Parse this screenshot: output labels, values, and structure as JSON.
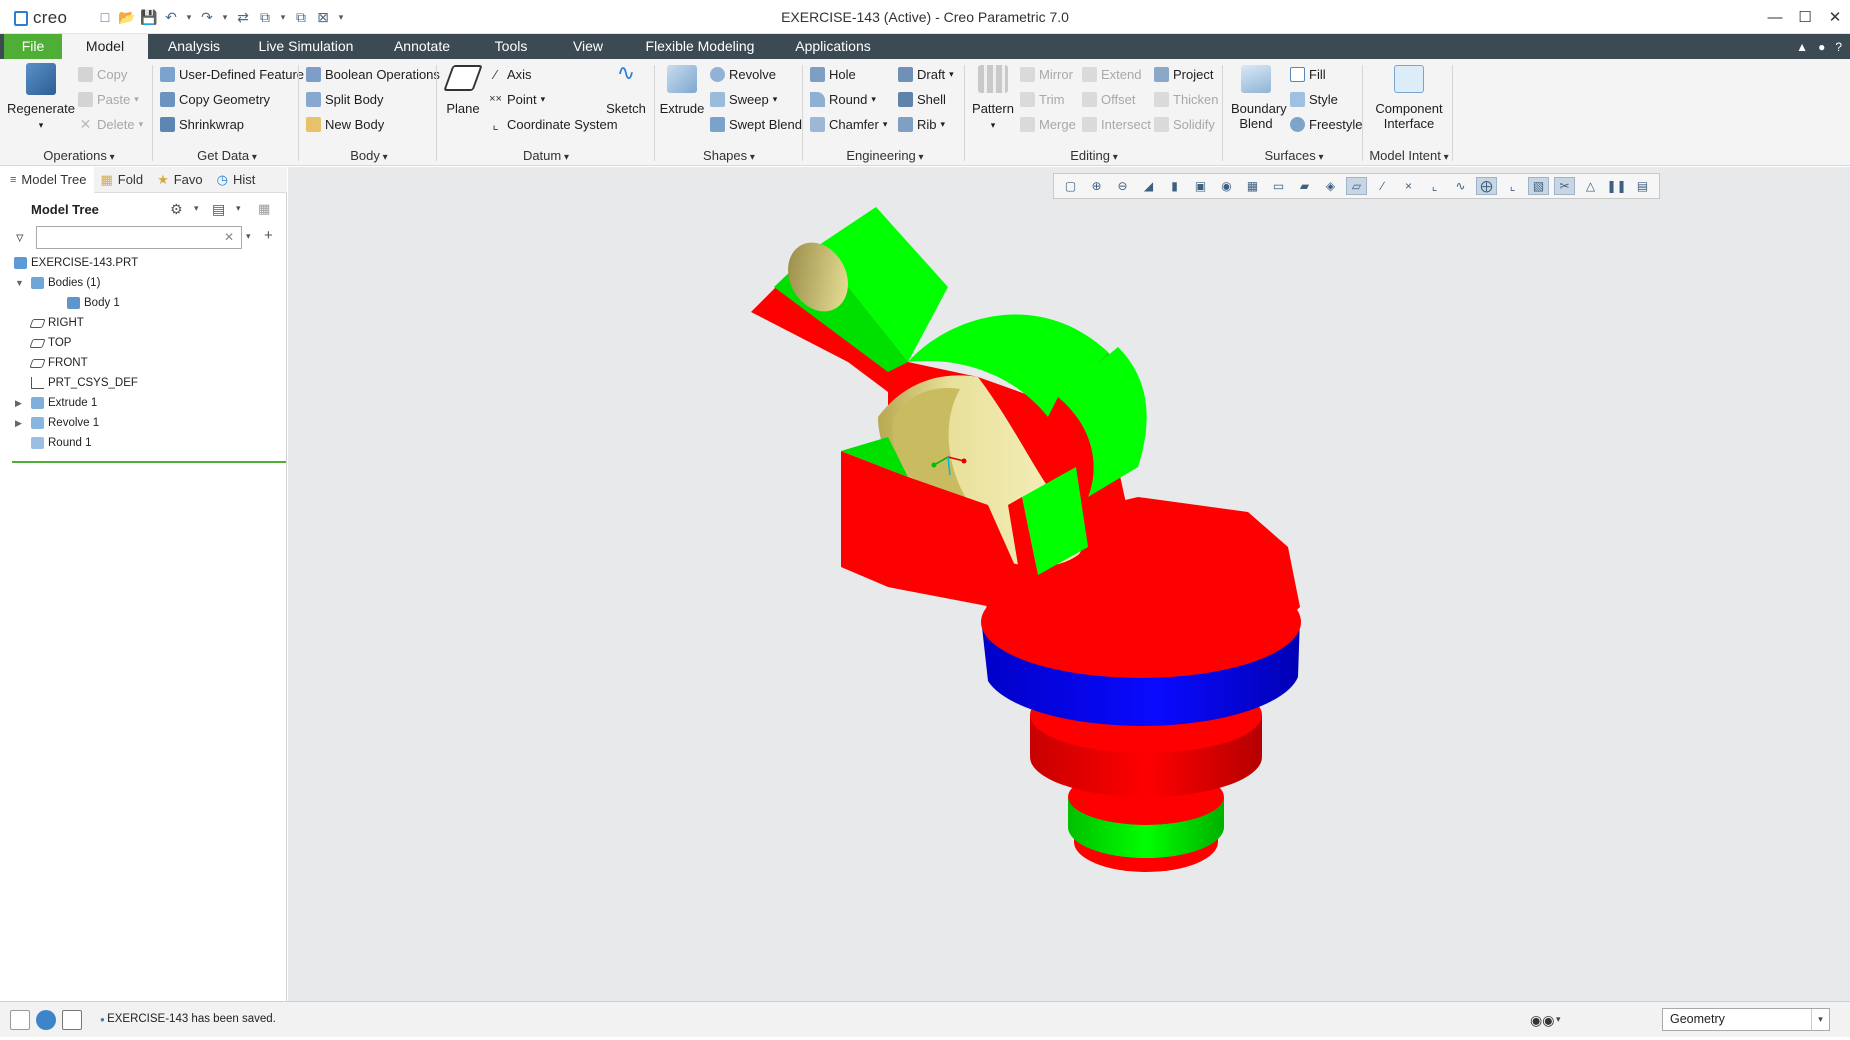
{
  "window": {
    "title": "EXERCISE-143 (Active) - Creo Parametric 7.0",
    "app_logo_text": "creo",
    "controls": {
      "minimize": "—",
      "maximize": "☐",
      "close": "✕"
    }
  },
  "quick_access": [
    "new-icon",
    "open-icon",
    "save-icon",
    "undo-icon",
    "redo-icon",
    "regenerate-icon",
    "windows-icon",
    "repaint-icon",
    "close-window-icon"
  ],
  "tabs": [
    {
      "label": "File"
    },
    {
      "label": "Model"
    },
    {
      "label": "Analysis"
    },
    {
      "label": "Live Simulation"
    },
    {
      "label": "Annotate"
    },
    {
      "label": "Tools"
    },
    {
      "label": "View"
    },
    {
      "label": "Flexible Modeling"
    },
    {
      "label": "Applications"
    }
  ],
  "ribbon": {
    "operations": {
      "label": "Operations",
      "regenerate": "Regenerate",
      "copy": "Copy",
      "paste": "Paste",
      "delete": "Delete"
    },
    "get_data": {
      "label": "Get Data",
      "udf": "User-Defined Feature",
      "copy_geometry": "Copy Geometry",
      "shrinkwrap": "Shrinkwrap"
    },
    "body": {
      "label": "Body",
      "boolean": "Boolean Operations",
      "split": "Split Body",
      "new": "New Body"
    },
    "datum": {
      "label": "Datum",
      "plane": "Plane",
      "axis": "Axis",
      "point": "Point",
      "csys": "Coordinate System",
      "sketch": "Sketch"
    },
    "shapes": {
      "label": "Shapes",
      "extrude": "Extrude",
      "revolve": "Revolve",
      "sweep": "Sweep",
      "swept_blend": "Swept Blend"
    },
    "engineering": {
      "label": "Engineering",
      "hole": "Hole",
      "round": "Round",
      "chamfer": "Chamfer",
      "draft": "Draft",
      "shell": "Shell",
      "rib": "Rib"
    },
    "editing": {
      "label": "Editing",
      "pattern": "Pattern",
      "mirror": "Mirror",
      "trim": "Trim",
      "merge": "Merge",
      "extend": "Extend",
      "offset": "Offset",
      "intersect": "Intersect",
      "project": "Project",
      "thicken": "Thicken",
      "solidify": "Solidify"
    },
    "surfaces": {
      "label": "Surfaces",
      "boundary_blend": "Boundary Blend",
      "fill": "Fill",
      "style": "Style",
      "freestyle": "Freestyle"
    },
    "model_intent": {
      "label": "Model Intent",
      "component_interface": "Component Interface"
    }
  },
  "left_panel": {
    "tabs": [
      {
        "label": "Model Tree",
        "icon": "model-tree-icon"
      },
      {
        "label": "Fold",
        "icon": "folder-icon"
      },
      {
        "label": "Favo",
        "icon": "favorites-icon"
      },
      {
        "label": "Hist",
        "icon": "history-icon"
      }
    ],
    "tree_title": "Model Tree",
    "search_placeholder": "",
    "tree": [
      {
        "label": "EXERCISE-143.PRT",
        "icon": "part-icon",
        "level": 0,
        "expander": ""
      },
      {
        "label": "Bodies (1)",
        "icon": "bodies-icon",
        "level": 0,
        "expander": "▼"
      },
      {
        "label": "Body 1",
        "icon": "body-icon",
        "level": 1,
        "expander": ""
      },
      {
        "label": "RIGHT",
        "icon": "datum-plane-icon",
        "level": 0,
        "expander": ""
      },
      {
        "label": "TOP",
        "icon": "datum-plane-icon",
        "level": 0,
        "expander": ""
      },
      {
        "label": "FRONT",
        "icon": "datum-plane-icon",
        "level": 0,
        "expander": ""
      },
      {
        "label": "PRT_CSYS_DEF",
        "icon": "csys-icon",
        "level": 0,
        "expander": ""
      },
      {
        "label": "Extrude 1",
        "icon": "extrude-icon",
        "level": 0,
        "expander": "▶"
      },
      {
        "label": "Revolve 1",
        "icon": "revolve-icon",
        "level": 0,
        "expander": "▶"
      },
      {
        "label": "Round 1",
        "icon": "round-icon",
        "level": 0,
        "expander": ""
      }
    ]
  },
  "view_toolbar": [
    "refit-icon",
    "zoom-in-icon",
    "zoom-out-icon",
    "repaint-icon",
    "display-style-icon",
    "saved-orientations-icon",
    "view-manager-icon",
    "perspective-icon",
    "annotation-display-icon",
    "plane-display-icon",
    "axis-display-icon",
    "point-display-icon",
    "csys-display-icon",
    "spin-center-icon",
    "section-icon",
    "appearance-icon",
    "render-icon",
    "pause-icon",
    "more-icon"
  ],
  "status": {
    "message": "EXERCISE-143 has been saved.",
    "filter_value": "Geometry"
  }
}
